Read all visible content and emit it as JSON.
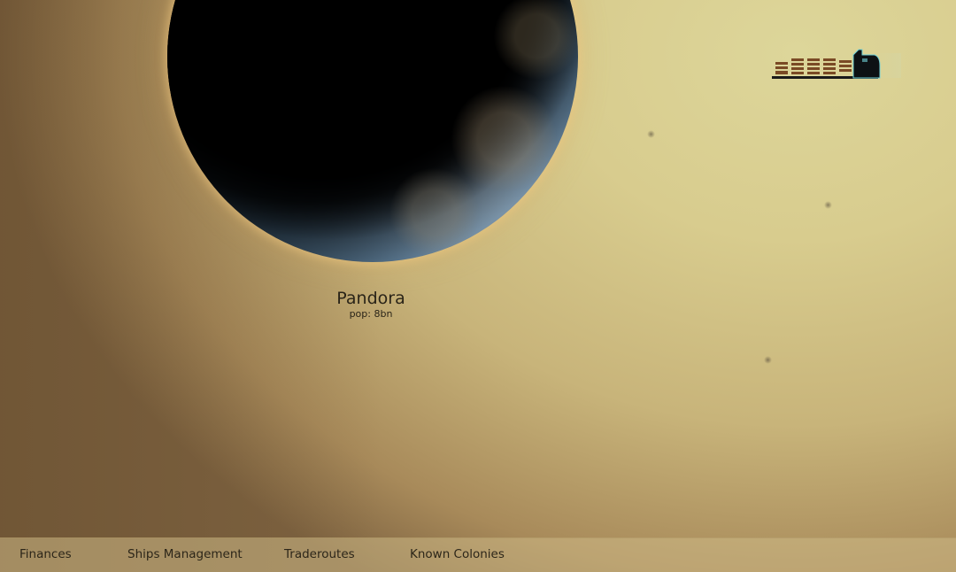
{
  "planet": {
    "name": "Pandora",
    "population": "pop: 8bn"
  },
  "ship": {
    "icon": "cargo-ship-icon"
  },
  "nav": {
    "items": [
      {
        "label": "Finances"
      },
      {
        "label": "Ships Management"
      },
      {
        "label": "Traderoutes"
      },
      {
        "label": "Known Colonies"
      }
    ]
  },
  "colors": {
    "sky": "#d8cc8e",
    "accent_glow": "#f0c882",
    "text": "#2a2418"
  }
}
